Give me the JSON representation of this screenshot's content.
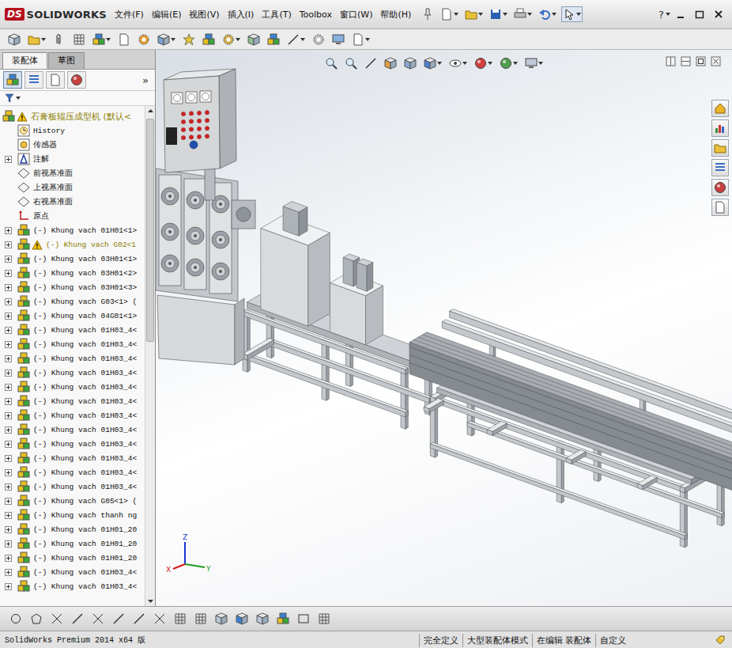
{
  "window": {
    "logo_mark": "DS",
    "logo_name": "SOLIDWORKS",
    "help": "?"
  },
  "menu": [
    "文件(F)",
    "编辑(E)",
    "视图(V)",
    "插入(I)",
    "工具(T)",
    "Toolbox",
    "窗口(W)",
    "帮助(H)"
  ],
  "sidebar": {
    "tabs": [
      {
        "label": "装配体",
        "selected": true
      },
      {
        "label": "草图",
        "selected": false
      }
    ],
    "panel_tabs": [
      {
        "selected": true
      },
      {
        "selected": false
      },
      {
        "selected": false
      },
      {
        "selected": false
      }
    ],
    "more": "»",
    "tree": [
      {
        "label": "石膏板辊压成型机 (默认<",
        "kind": "assembly",
        "depth": 0,
        "expandable": false,
        "warning": true
      },
      {
        "label": "History",
        "kind": "history",
        "depth": 1,
        "expandable": false,
        "warning": false
      },
      {
        "label": "传感器",
        "kind": "sensor",
        "depth": 1,
        "expandable": false,
        "warning": false
      },
      {
        "label": "注解",
        "kind": "annotation",
        "depth": 1,
        "expandable": true,
        "warning": false
      },
      {
        "label": "前视基准面",
        "kind": "plane",
        "depth": 1,
        "expandable": false,
        "warning": false
      },
      {
        "label": "上视基准面",
        "kind": "plane",
        "depth": 1,
        "expandable": false,
        "warning": false
      },
      {
        "label": "右视基准面",
        "kind": "plane",
        "depth": 1,
        "expandable": false,
        "warning": false
      },
      {
        "label": "原点",
        "kind": "origin",
        "depth": 1,
        "expandable": false,
        "warning": false
      },
      {
        "label": "(-) Khung vach 01H01<1>",
        "kind": "component",
        "depth": 1,
        "expandable": true,
        "warning": false
      },
      {
        "label": "(-) Khung vach G02<1",
        "kind": "component",
        "depth": 1,
        "expandable": true,
        "warning": true
      },
      {
        "label": "(-) Khung vach 03H01<1>",
        "kind": "component",
        "depth": 1,
        "expandable": true,
        "warning": false
      },
      {
        "label": "(-) Khung vach 03H01<2>",
        "kind": "component",
        "depth": 1,
        "expandable": true,
        "warning": false
      },
      {
        "label": "(-) Khung vach 03H01<3>",
        "kind": "component",
        "depth": 1,
        "expandable": true,
        "warning": false
      },
      {
        "label": "(-) Khung vach G03<1> (",
        "kind": "component",
        "depth": 1,
        "expandable": true,
        "warning": false
      },
      {
        "label": "(-) Khung vach 04G01<1>",
        "kind": "component",
        "depth": 1,
        "expandable": true,
        "warning": false
      },
      {
        "label": "(-) Khung vach 01H03_4<",
        "kind": "component",
        "depth": 1,
        "expandable": true,
        "warning": false
      },
      {
        "label": "(-) Khung vach 01H03_4<",
        "kind": "component",
        "depth": 1,
        "expandable": true,
        "warning": false
      },
      {
        "label": "(-) Khung vach 01H03_4<",
        "kind": "component",
        "depth": 1,
        "expandable": true,
        "warning": false
      },
      {
        "label": "(-) Khung vach 01H03_4<",
        "kind": "component",
        "depth": 1,
        "expandable": true,
        "warning": false
      },
      {
        "label": "(-) Khung vach 01H03_4<",
        "kind": "component",
        "depth": 1,
        "expandable": true,
        "warning": false
      },
      {
        "label": "(-) Khung vach 01H03_4<",
        "kind": "component",
        "depth": 1,
        "expandable": true,
        "warning": false
      },
      {
        "label": "(-) Khung vach 01H03_4<",
        "kind": "component",
        "depth": 1,
        "expandable": true,
        "warning": false
      },
      {
        "label": "(-) Khung vach 01H03_4<",
        "kind": "component",
        "depth": 1,
        "expandable": true,
        "warning": false
      },
      {
        "label": "(-) Khung vach 01H03_4<",
        "kind": "component",
        "depth": 1,
        "expandable": true,
        "warning": false
      },
      {
        "label": "(-) Khung vach 01H03_4<",
        "kind": "component",
        "depth": 1,
        "expandable": true,
        "warning": false
      },
      {
        "label": "(-) Khung vach 01H03_4<",
        "kind": "component",
        "depth": 1,
        "expandable": true,
        "warning": false
      },
      {
        "label": "(-) Khung vach 01H03_4<",
        "kind": "component",
        "depth": 1,
        "expandable": true,
        "warning": false
      },
      {
        "label": "(-) Khung vach G05<1> (",
        "kind": "component",
        "depth": 1,
        "expandable": true,
        "warning": false
      },
      {
        "label": "(-) Khung vach thanh ng",
        "kind": "component",
        "depth": 1,
        "expandable": true,
        "warning": false
      },
      {
        "label": "(-) Khung vach 01H01_20",
        "kind": "component",
        "depth": 1,
        "expandable": true,
        "warning": false
      },
      {
        "label": "(-) Khung vach 01H01_20",
        "kind": "component",
        "depth": 1,
        "expandable": true,
        "warning": false
      },
      {
        "label": "(-) Khung vach 01H01_20",
        "kind": "component",
        "depth": 1,
        "expandable": true,
        "warning": false
      },
      {
        "label": "(-) Khung vach 01H03_4<",
        "kind": "component",
        "depth": 1,
        "expandable": true,
        "warning": false
      },
      {
        "label": "(-) Khung vach 01H03_4<",
        "kind": "component",
        "depth": 1,
        "expandable": true,
        "warning": false
      }
    ]
  },
  "viewport": {
    "triad": [
      {
        "label": "X",
        "color": "#d01818"
      },
      {
        "label": "Y",
        "color": "#1a9a1a"
      },
      {
        "label": "Z",
        "color": "#1a36d0"
      }
    ]
  },
  "status_bar": {
    "product": "SolidWorks Premium 2014 x64 版",
    "cells": [
      "完全定义",
      "大型装配体模式",
      "在编辑 装配体",
      "自定义"
    ]
  }
}
